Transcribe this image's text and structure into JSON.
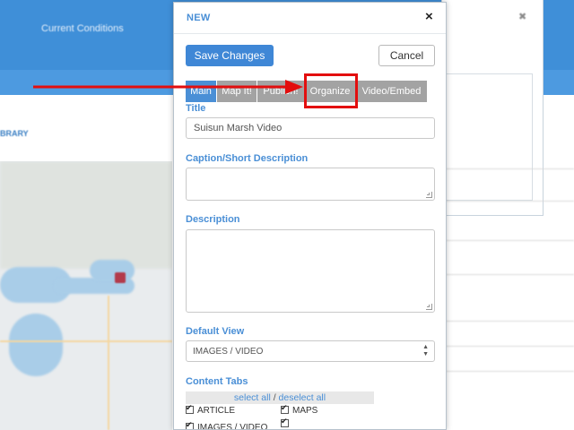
{
  "background": {
    "nav_items": [
      "Current Conditions"
    ],
    "library_label": "BRARY"
  },
  "modal": {
    "title": "NEW",
    "close_label": "×",
    "save_label": "Save Changes",
    "cancel_label": "Cancel",
    "tabs": [
      {
        "label": "Main",
        "active": true
      },
      {
        "label": "Map It!",
        "active": false
      },
      {
        "label": "Publish!",
        "active": false
      },
      {
        "label": "Organize",
        "active": false
      },
      {
        "label": "Video/Embed",
        "active": false
      }
    ],
    "title_field": {
      "label": "Title",
      "value": "Suisun Marsh Video"
    },
    "caption_field": {
      "label": "Caption/Short Description",
      "value": ""
    },
    "description_field": {
      "label": "Description",
      "value": ""
    },
    "default_view": {
      "label": "Default View",
      "selected": "IMAGES / VIDEO"
    },
    "content_tabs": {
      "label": "Content Tabs",
      "select_all": "select all",
      "separator": "/",
      "deselect_all": "deselect all",
      "options": [
        {
          "label": "ARTICLE",
          "checked": true
        },
        {
          "label": "MAPS",
          "checked": true
        },
        {
          "label": "IMAGES / VIDEO",
          "checked": true
        },
        {
          "label": "",
          "checked": true
        }
      ]
    }
  },
  "colors": {
    "accent": "#4a8fd6",
    "annotation": "#e30e0e",
    "tab_inactive": "#a3a3a3"
  }
}
